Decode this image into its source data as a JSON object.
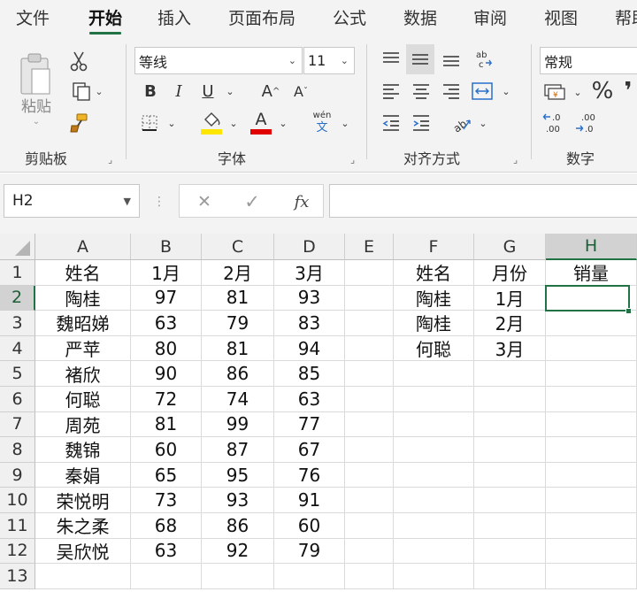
{
  "tabs": [
    "文件",
    "开始",
    "插入",
    "页面布局",
    "公式",
    "数据",
    "审阅",
    "视图",
    "帮助"
  ],
  "active_tab": "开始",
  "ribbon": {
    "clipboard": {
      "paste_label": "粘贴",
      "group_label": "剪贴板"
    },
    "font": {
      "font_name": "等线",
      "font_size": "11",
      "bold": "B",
      "italic": "I",
      "underline": "U",
      "grow": "A",
      "shrink": "A",
      "font_color_letter": "A",
      "phonetic_top": "wén",
      "phonetic_bottom": "文",
      "group_label": "字体",
      "fill_color": "#ffe600",
      "font_color": "#e00000"
    },
    "alignment": {
      "group_label": "对齐方式"
    },
    "number": {
      "format": "常规",
      "percent": "%",
      "comma": "❜",
      "group_label": "数字"
    }
  },
  "formula_bar": {
    "name_box": "H2",
    "cancel": "✕",
    "enter": "✓",
    "fx": "fx",
    "formula": ""
  },
  "columns": [
    "A",
    "B",
    "C",
    "D",
    "E",
    "F",
    "G",
    "H"
  ],
  "selected_cell": "H2",
  "rows": [
    {
      "n": "1",
      "cells": [
        "姓名",
        "1月",
        "2月",
        "3月",
        "",
        "姓名",
        "月份",
        "销量"
      ]
    },
    {
      "n": "2",
      "cells": [
        "陶桂",
        "97",
        "81",
        "93",
        "",
        "陶桂",
        "1月",
        ""
      ]
    },
    {
      "n": "3",
      "cells": [
        "魏昭娣",
        "63",
        "79",
        "83",
        "",
        "陶桂",
        "2月",
        ""
      ]
    },
    {
      "n": "4",
      "cells": [
        "严苹",
        "80",
        "81",
        "94",
        "",
        "何聪",
        "3月",
        ""
      ]
    },
    {
      "n": "5",
      "cells": [
        "褚欣",
        "90",
        "86",
        "85",
        "",
        "",
        "",
        ""
      ]
    },
    {
      "n": "6",
      "cells": [
        "何聪",
        "72",
        "74",
        "63",
        "",
        "",
        "",
        ""
      ]
    },
    {
      "n": "7",
      "cells": [
        "周苑",
        "81",
        "99",
        "77",
        "",
        "",
        "",
        ""
      ]
    },
    {
      "n": "8",
      "cells": [
        "魏锦",
        "60",
        "87",
        "67",
        "",
        "",
        "",
        ""
      ]
    },
    {
      "n": "9",
      "cells": [
        "秦娟",
        "65",
        "95",
        "76",
        "",
        "",
        "",
        ""
      ]
    },
    {
      "n": "10",
      "cells": [
        "荣悦明",
        "73",
        "93",
        "91",
        "",
        "",
        "",
        ""
      ]
    },
    {
      "n": "11",
      "cells": [
        "朱之柔",
        "68",
        "86",
        "60",
        "",
        "",
        "",
        ""
      ]
    },
    {
      "n": "12",
      "cells": [
        "吴欣悦",
        "63",
        "92",
        "79",
        "",
        "",
        "",
        ""
      ]
    },
    {
      "n": "13",
      "cells": [
        "",
        "",
        "",
        "",
        "",
        "",
        "",
        ""
      ]
    }
  ],
  "accent_color": "#217346"
}
